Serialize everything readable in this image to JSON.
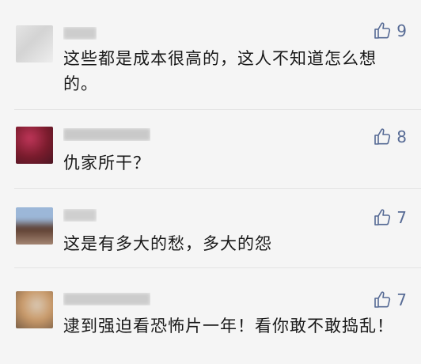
{
  "comments": [
    {
      "likes": "9",
      "text": "这些都是成本很高的，这人不知道怎么想的。",
      "colors": {
        "avatar": [
          "#e9e9e9",
          "#d3d3d3",
          "#f4f4f4"
        ],
        "name_bar": "#cdcdcd"
      }
    },
    {
      "likes": "8",
      "text": "仇家所干？",
      "colors": {
        "avatar": [
          "#7a1b2c",
          "#c0365a",
          "#3a1520"
        ],
        "name_bar": "#c9c9c9"
      }
    },
    {
      "likes": "7",
      "text": "这是有多大的愁，多大的怨",
      "colors": {
        "avatar": [
          "#9cb7d8",
          "#5a3b2e",
          "#b89a86"
        ],
        "name_bar": "#cfcfcf"
      }
    },
    {
      "likes": "7",
      "text": "逮到强迫看恐怖片一年！看你敢不敢捣乱！",
      "colors": {
        "avatar": [
          "#c99a6a",
          "#5e4a3a",
          "#d9c8b4"
        ],
        "name_bar": "#cccccc"
      }
    }
  ],
  "icons": {
    "like": "thumbs-up-icon"
  },
  "theme": {
    "accent": "#576b95",
    "text": "#191919",
    "background": "#f5f5f5",
    "divider": "#e3e3e3"
  }
}
